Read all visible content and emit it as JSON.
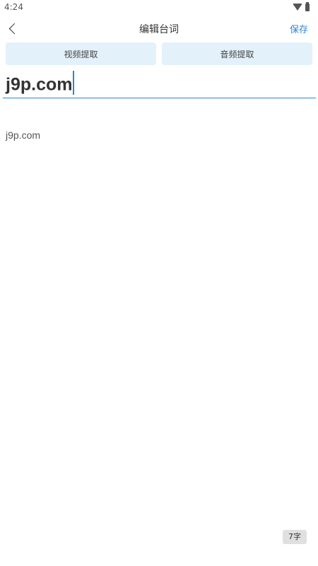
{
  "status_bar": {
    "time": "4:24",
    "icons": [
      "wifi-icon",
      "battery-icon"
    ]
  },
  "navbar": {
    "title": "编辑台词",
    "save_label": "保存",
    "back_icon": "chevron-left-icon"
  },
  "extract_buttons": {
    "video_label": "视频提取",
    "audio_label": "音频提取"
  },
  "editor": {
    "title_value": "j9p.com",
    "body_text": "j9p.com",
    "char_count": "7字"
  },
  "colors": {
    "accent": "#2b86d6",
    "button_bg": "#e3f1fb",
    "badge_bg": "#e0e0e0"
  }
}
